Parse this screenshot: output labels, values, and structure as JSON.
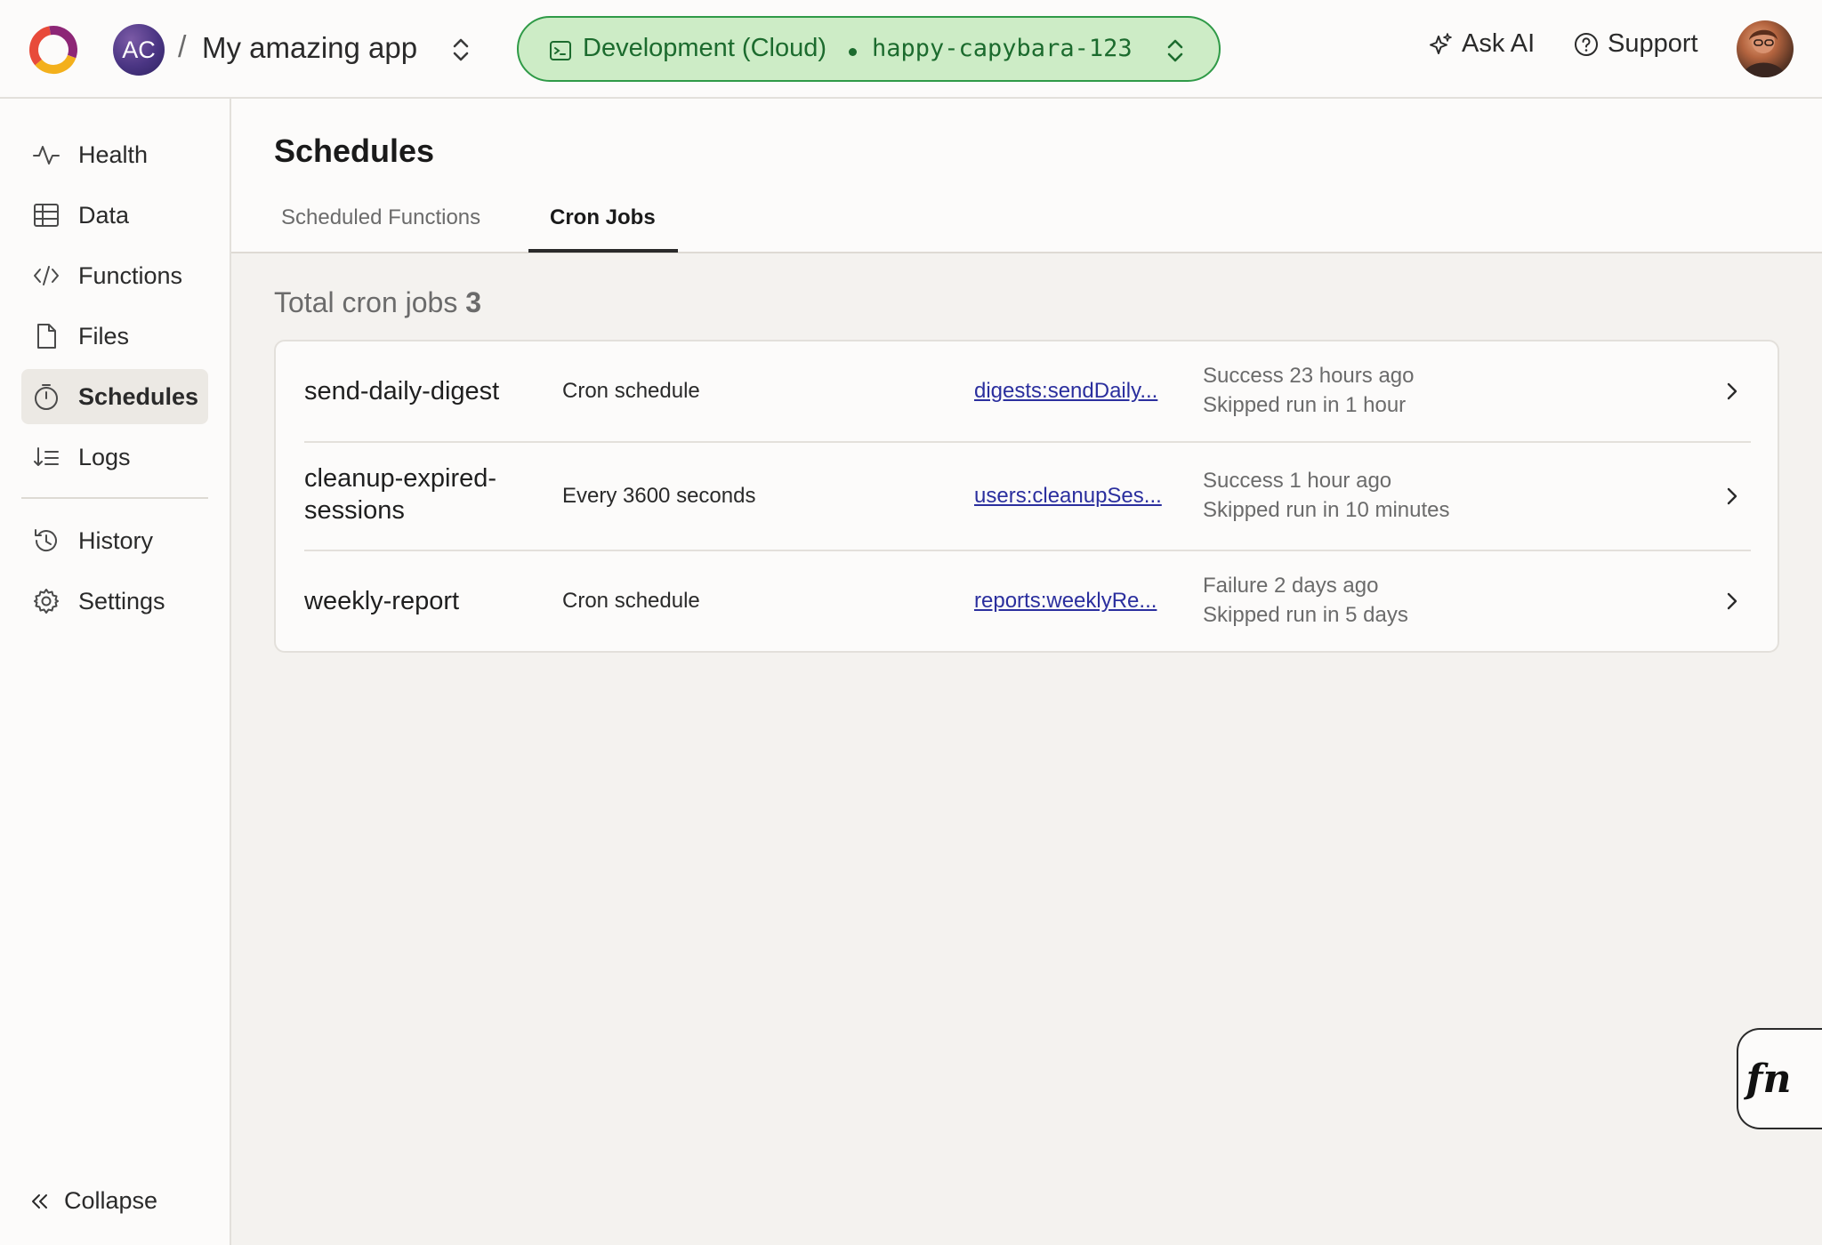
{
  "header": {
    "team_initials": "AC",
    "separator": "/",
    "project_name": "My amazing app",
    "deployment": {
      "label": "Development (Cloud)",
      "name": "happy-capybara-123"
    },
    "ask_ai_label": "Ask AI",
    "support_label": "Support"
  },
  "sidebar": {
    "items": [
      {
        "label": "Health",
        "icon": "pulse-icon"
      },
      {
        "label": "Data",
        "icon": "table-icon"
      },
      {
        "label": "Functions",
        "icon": "code-icon"
      },
      {
        "label": "Files",
        "icon": "file-icon"
      },
      {
        "label": "Schedules",
        "icon": "stopwatch-icon",
        "active": true
      },
      {
        "label": "Logs",
        "icon": "logs-icon"
      },
      {
        "label": "History",
        "icon": "history-icon"
      },
      {
        "label": "Settings",
        "icon": "gear-icon"
      }
    ],
    "collapse_label": "Collapse"
  },
  "page": {
    "title": "Schedules",
    "tabs": [
      {
        "label": "Scheduled Functions",
        "active": false
      },
      {
        "label": "Cron Jobs",
        "active": true
      }
    ],
    "total_label": "Total cron jobs",
    "total_count": "3"
  },
  "cron_jobs": [
    {
      "name": "send-daily-digest",
      "schedule": "Cron schedule",
      "function": "digests:sendDaily...",
      "last_run": "Success 23 hours ago",
      "next_run": "Skipped run in 1 hour"
    },
    {
      "name": "cleanup-expired-sessions",
      "schedule": "Every 3600 seconds",
      "function": "users:cleanupSes...",
      "last_run": "Success 1 hour ago",
      "next_run": "Skipped run in 10 minutes"
    },
    {
      "name": "weekly-report",
      "schedule": "Cron schedule",
      "function": "reports:weeklyRe...",
      "last_run": "Failure 2 days ago",
      "next_run": "Skipped run in 5 days"
    }
  ],
  "fn_button_label": "fn",
  "colors": {
    "deployment_bg": "#cdecc6",
    "deployment_border": "#2f9a47",
    "deployment_text": "#1c6b2e",
    "link": "#2b2f9e"
  }
}
